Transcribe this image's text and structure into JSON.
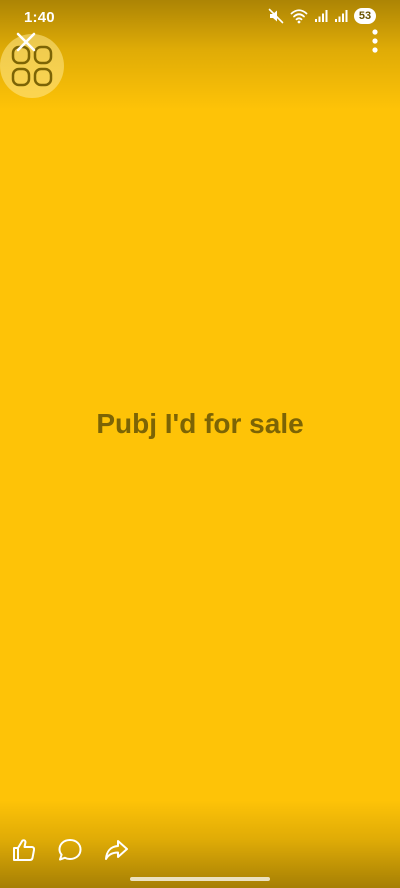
{
  "status_bar": {
    "time": "1:40",
    "battery": "53",
    "icons": [
      "mute-icon",
      "wifi-icon",
      "signal-icon",
      "signal-icon",
      "battery-icon"
    ]
  },
  "top_bar": {
    "close_icon": "close-icon",
    "app_grid_icon": "app-grid-icon",
    "more_icon": "more-vertical-icon"
  },
  "post": {
    "text": "Pubj I'd for sale",
    "background_color": "#FEC307",
    "text_color": "#7C6405"
  },
  "actions": {
    "like_icon": "thumbs-up-icon",
    "comment_icon": "comment-icon",
    "share_icon": "share-icon"
  }
}
